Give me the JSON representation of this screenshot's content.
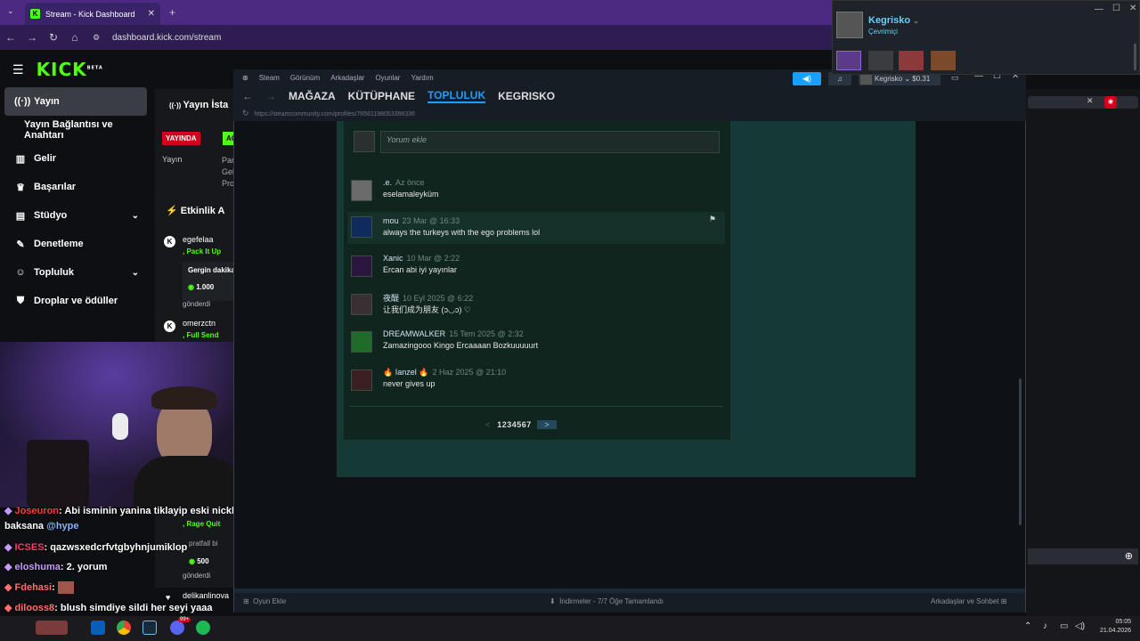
{
  "browser": {
    "tab_title": "Stream - Kick Dashboard",
    "url": "dashboard.kick.com/stream",
    "new_tab": "+"
  },
  "kick": {
    "logo": "KICK",
    "logo_sup": "BETA",
    "sidebar": [
      {
        "label": "Yayın",
        "icon": "broadcast-icon",
        "active": true
      },
      {
        "label": "Yayın Bağlantısı ve Anahtarı",
        "sub": true
      },
      {
        "label": "Gelir",
        "icon": "chart-icon"
      },
      {
        "label": "Başarılar",
        "icon": "trophy-icon"
      },
      {
        "label": "Stüdyo",
        "icon": "studio-icon",
        "chevron": true
      },
      {
        "label": "Denetleme",
        "icon": "wrench-icon"
      },
      {
        "label": "Topluluk",
        "icon": "community-icon",
        "chevron": true
      },
      {
        "label": "Droplar ve ödüller",
        "icon": "gift-icon"
      }
    ],
    "mid": {
      "title": "Yayın İsta",
      "badge_live": "YAYINDA",
      "badge_ac": "AÇ",
      "yayin": "Yayın",
      "col": [
        "Par",
        "Gel",
        "Pro"
      ],
      "events_title": "Etkinlik A",
      "events": [
        {
          "user": "egefelaa",
          "action": "Pack It Up",
          "detail": "Gergin dakika",
          "amount": "1.000",
          "sent": "gönderdi"
        },
        {
          "user": "omerzctn",
          "action": "Full Send"
        },
        {
          "user": "",
          "action": "Rage Quit",
          "detail": "pratfall bi",
          "amount": "500",
          "sent": "gönderdi"
        },
        {
          "user": "delikanlinova",
          "action": ""
        }
      ]
    },
    "chat": [
      {
        "user": "Joseuron",
        "color": "#ff3b3b",
        "text": ": Abi isminin yanina tiklayip eski nicklerine"
      },
      {
        "user": "",
        "text": "baksana",
        "mention": "@hype"
      },
      {
        "user": "ICSES",
        "color": "#ff3b6b",
        "text": ": qazwsxedcrfvtgbyhnjumiklop"
      },
      {
        "user": "eloshuma",
        "color": "#c59bff",
        "text": ": 2. yorum"
      },
      {
        "user": "Fdehasi",
        "color": "#ff6f6f",
        "text": ":"
      },
      {
        "user": "dilooss8",
        "color": "#ff6f6f",
        "text": ": blush simdiye sildi her seyi yaaa"
      }
    ]
  },
  "steam": {
    "menu": [
      "Steam",
      "Görünüm",
      "Arkadaşlar",
      "Oyunlar",
      "Yardım"
    ],
    "nav": [
      "MAĞAZA",
      "KÜTÜPHANE",
      "TOPLULUK",
      "KEGRISKO"
    ],
    "active_nav": "TOPLULUK",
    "account": "Kegrisko",
    "balance": "$0.31",
    "url": "https://steamcommunity.com/profiles/76561198053396336",
    "comment_placeholder": "Yorum ekle",
    "comments": [
      {
        "name": ".e.",
        "date": "Az önce",
        "text": "eselamaleyküm"
      },
      {
        "name": "mou",
        "date": "23 Mar @ 16:33",
        "text": "always the turkeys with the ego problems lol"
      },
      {
        "name": "Xanic",
        "date": "10 Mar @ 2:22",
        "text": "Ercan abi iyi yayınlar"
      },
      {
        "name": "夜醍",
        "date": "10 Eyl 2025 @ 6:22",
        "text": "让我们成为朋友 (ɔ◡ɔ) ♡"
      },
      {
        "name": "DREAMWALKER",
        "date": "15 Tem 2025 @ 2:32",
        "text": "Zamazingooo Kingo Ercaaaan Bozkuuuuurt"
      },
      {
        "name": "🔥 Ianzel 🔥",
        "date": "2 Haz 2025 @ 21:10",
        "text": "never gives up"
      }
    ],
    "pagination": {
      "prev": "<",
      "pages": "1 2 3 4 5 6 7",
      "next": ">"
    },
    "footer": {
      "add_game": "Oyun Ekle",
      "downloads": "İndirmeler - 7/7 Öğe Tamamlandı",
      "friends": "Arkadaşlar ve Sohbet"
    }
  },
  "friends_popup": {
    "name": "Kegrisko",
    "status": "Çevrimiçi"
  },
  "taskbar": {
    "time": "05:05",
    "date": "21.04.2026",
    "badge": "99+"
  }
}
